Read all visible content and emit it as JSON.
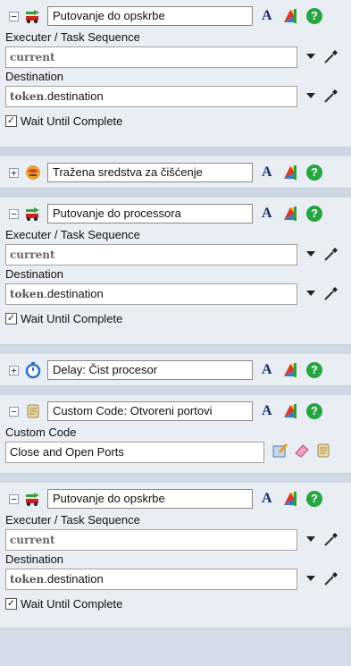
{
  "tasks": [
    {
      "name": "Putovanje do opskrbe",
      "executer_label": "Executer / Task Sequence",
      "executer_value": "current",
      "dest_label": "Destination",
      "dest_kw": "token",
      "dest_rest": ".destination",
      "wait_label": "Wait Until Complete"
    },
    {
      "name": "Tražena sredstva za čišćenje"
    },
    {
      "name": "Putovanje do processora",
      "executer_label": "Executer / Task Sequence",
      "executer_value": "current",
      "dest_label": "Destination",
      "dest_kw": "token",
      "dest_rest": ".destination",
      "wait_label": "Wait Until Complete"
    },
    {
      "name": "Delay: Čist procesor"
    },
    {
      "name": "Custom Code: Otvoreni portovi",
      "code_label": "Custom Code",
      "code_value": "Close and Open Ports"
    },
    {
      "name": "Putovanje do opskrbe",
      "executer_label": "Executer / Task Sequence",
      "executer_value": "current",
      "dest_label": "Destination",
      "dest_kw": "token",
      "dest_rest": ".destination",
      "wait_label": "Wait Until Complete"
    }
  ],
  "controls": {
    "toggle_collapse": "−",
    "toggle_expand": "+",
    "font_button": "A",
    "help_button": "?",
    "check_mark": "✓"
  },
  "colors": {
    "help_green": "#26a641",
    "panel_bg": "#e9eef4",
    "separator": "#cfd8e3"
  }
}
